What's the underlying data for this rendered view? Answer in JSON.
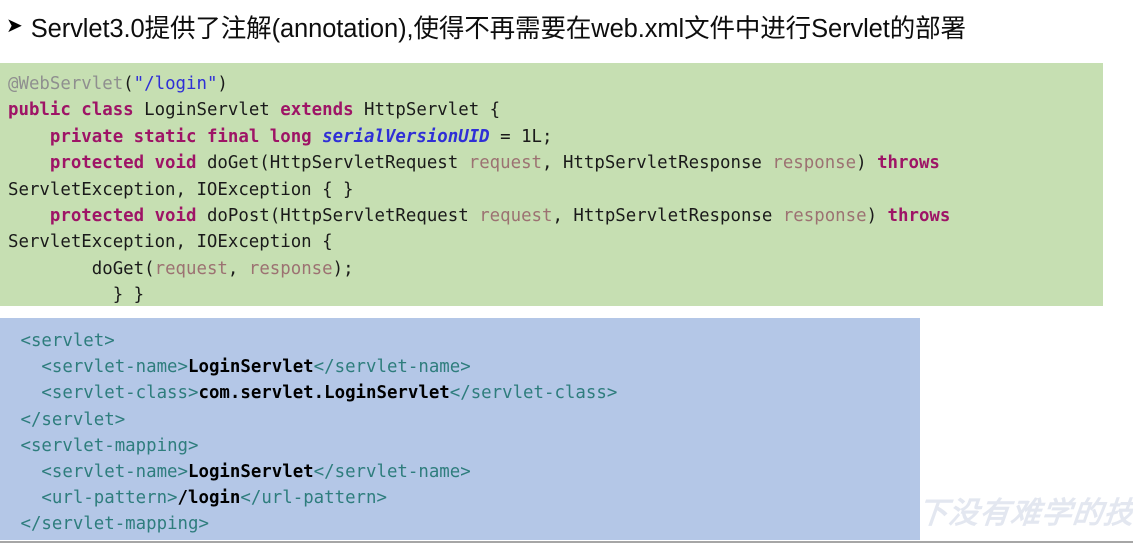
{
  "slide": {
    "bullet_glyph": "➜",
    "bullet_icon_name": "arrow-bullet-icon",
    "heading": "Servlet3.0提供了注解(annotation),使得不再需要在web.xml文件中进行Servlet的部署",
    "watermark": "下没有难学的技术",
    "colors": {
      "java_block_bg": "#c6dfb2",
      "xml_block_bg": "#b4c7e7",
      "keyword": "#9e1466",
      "string": "#2f2fd6",
      "annotation": "#8f8f8f",
      "parameter": "#9c7272",
      "xml_tag": "#2e7d7d",
      "rule": "#a6a6a6"
    }
  },
  "java_code": {
    "language": "java",
    "lines": [
      [
        {
          "t": "@WebServlet",
          "c": "j-anno"
        },
        {
          "t": "(",
          "c": "j-plain"
        },
        {
          "t": "\"/login\"",
          "c": "j-str"
        },
        {
          "t": ")",
          "c": "j-plain"
        }
      ],
      [
        {
          "t": "public class ",
          "c": "j-kw"
        },
        {
          "t": "LoginServlet ",
          "c": "j-plain"
        },
        {
          "t": "extends ",
          "c": "j-kw"
        },
        {
          "t": "HttpServlet {",
          "c": "j-plain"
        }
      ],
      [
        {
          "t": "    ",
          "c": "j-plain"
        },
        {
          "t": "private static final long ",
          "c": "j-kw"
        },
        {
          "t": "serialVersionUID",
          "c": "j-field"
        },
        {
          "t": " = 1L;",
          "c": "j-plain"
        }
      ],
      [
        {
          "t": "    ",
          "c": "j-plain"
        },
        {
          "t": "protected void ",
          "c": "j-kw"
        },
        {
          "t": "doGet(HttpServletRequest ",
          "c": "j-plain"
        },
        {
          "t": "request",
          "c": "j-param"
        },
        {
          "t": ", HttpServletResponse ",
          "c": "j-plain"
        },
        {
          "t": "response",
          "c": "j-param"
        },
        {
          "t": ") ",
          "c": "j-plain"
        },
        {
          "t": "throws",
          "c": "j-kw"
        },
        {
          "t": "\nServletException, IOException { }",
          "c": "j-plain"
        }
      ],
      [
        {
          "t": "    ",
          "c": "j-plain"
        },
        {
          "t": "protected void ",
          "c": "j-kw"
        },
        {
          "t": "doPost(HttpServletRequest ",
          "c": "j-plain"
        },
        {
          "t": "request",
          "c": "j-param"
        },
        {
          "t": ", HttpServletResponse ",
          "c": "j-plain"
        },
        {
          "t": "response",
          "c": "j-param"
        },
        {
          "t": ") ",
          "c": "j-plain"
        },
        {
          "t": "throws",
          "c": "j-kw"
        },
        {
          "t": "\nServletException, IOException {",
          "c": "j-plain"
        }
      ],
      [
        {
          "t": "        doGet(",
          "c": "j-plain"
        },
        {
          "t": "request",
          "c": "j-param"
        },
        {
          "t": ", ",
          "c": "j-plain"
        },
        {
          "t": "response",
          "c": "j-param"
        },
        {
          "t": ");",
          "c": "j-plain"
        }
      ],
      [
        {
          "t": "          } }",
          "c": "j-plain"
        }
      ]
    ]
  },
  "xml_code": {
    "language": "xml",
    "lines": [
      [
        {
          "t": " <servlet>",
          "c": "x-tag"
        }
      ],
      [
        {
          "t": "   <servlet-name>",
          "c": "x-tag"
        },
        {
          "t": "LoginServlet",
          "c": "x-val"
        },
        {
          "t": "</servlet-name>",
          "c": "x-tag"
        }
      ],
      [
        {
          "t": "   <servlet-class>",
          "c": "x-tag"
        },
        {
          "t": "com.servlet.LoginServlet",
          "c": "x-val"
        },
        {
          "t": "</servlet-class>",
          "c": "x-tag"
        }
      ],
      [
        {
          "t": " </servlet>",
          "c": "x-tag"
        }
      ],
      [
        {
          "t": " <servlet-mapping>",
          "c": "x-tag"
        }
      ],
      [
        {
          "t": "   <servlet-name>",
          "c": "x-tag"
        },
        {
          "t": "LoginServlet",
          "c": "x-val"
        },
        {
          "t": "</servlet-name>",
          "c": "x-tag"
        }
      ],
      [
        {
          "t": "   <url-pattern>",
          "c": "x-tag"
        },
        {
          "t": "/login",
          "c": "x-val"
        },
        {
          "t": "</url-pattern>",
          "c": "x-tag"
        }
      ],
      [
        {
          "t": " </servlet-mapping>",
          "c": "x-tag"
        }
      ]
    ]
  }
}
